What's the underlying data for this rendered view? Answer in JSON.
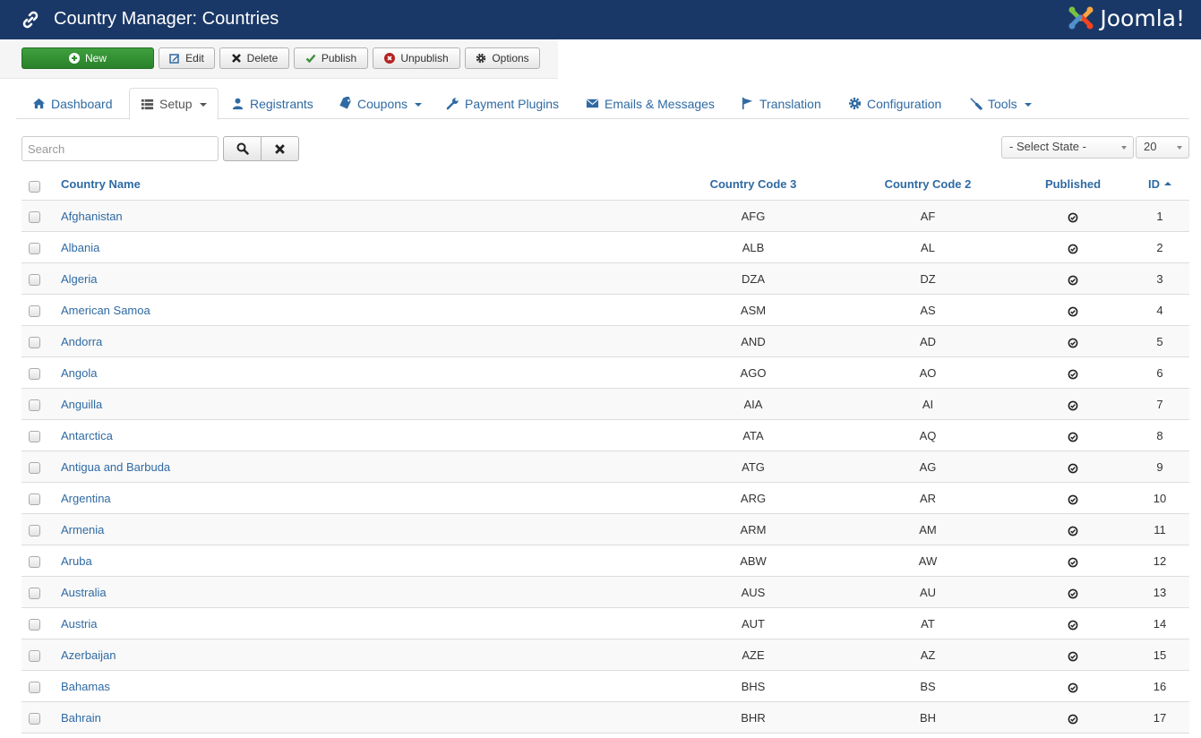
{
  "header": {
    "title": "Country Manager: Countries",
    "title_icon": "link-icon",
    "logo_text": "Joomla!",
    "background_color": "#1a3867"
  },
  "toolbar": {
    "buttons": [
      {
        "label": "New",
        "icon": "plus-circle-icon"
      },
      {
        "label": "Edit",
        "icon": "edit-icon"
      },
      {
        "label": "Delete",
        "icon": "x-icon"
      },
      {
        "label": "Publish",
        "icon": "check-icon"
      },
      {
        "label": "Unpublish",
        "icon": "x-circle-icon"
      },
      {
        "label": "Options",
        "icon": "gear-icon"
      }
    ],
    "new_color": "#2f8f2f"
  },
  "tabs": [
    {
      "label": "Dashboard",
      "icon": "home-icon",
      "dropdown": false
    },
    {
      "label": "Setup",
      "icon": "list-icon",
      "dropdown": true,
      "active": true
    },
    {
      "label": "Registrants",
      "icon": "user-icon",
      "dropdown": false
    },
    {
      "label": "Coupons",
      "icon": "tag-icon",
      "dropdown": true
    },
    {
      "label": "Payment Plugins",
      "icon": "wrench-icon",
      "dropdown": false
    },
    {
      "label": "Emails & Messages",
      "icon": "envelope-icon",
      "dropdown": false
    },
    {
      "label": "Translation",
      "icon": "flag-icon",
      "dropdown": false
    },
    {
      "label": "Configuration",
      "icon": "gear-icon",
      "dropdown": false
    },
    {
      "label": "Tools",
      "icon": "screwdriver-icon",
      "dropdown": true
    }
  ],
  "filters": {
    "search_placeholder": "Search",
    "search_value": "",
    "state_select": "- Select State -",
    "limit_select": "20"
  },
  "table": {
    "columns": {
      "name": "Country Name",
      "code3": "Country Code 3",
      "code2": "Country Code 2",
      "published": "Published",
      "id": "ID"
    },
    "sort": {
      "column": "ID",
      "direction": "asc"
    },
    "rows": [
      {
        "name": "Afghanistan",
        "code3": "AFG",
        "code2": "AF",
        "published": true,
        "id": "1"
      },
      {
        "name": "Albania",
        "code3": "ALB",
        "code2": "AL",
        "published": true,
        "id": "2"
      },
      {
        "name": "Algeria",
        "code3": "DZA",
        "code2": "DZ",
        "published": true,
        "id": "3"
      },
      {
        "name": "American Samoa",
        "code3": "ASM",
        "code2": "AS",
        "published": true,
        "id": "4"
      },
      {
        "name": "Andorra",
        "code3": "AND",
        "code2": "AD",
        "published": true,
        "id": "5"
      },
      {
        "name": "Angola",
        "code3": "AGO",
        "code2": "AO",
        "published": true,
        "id": "6"
      },
      {
        "name": "Anguilla",
        "code3": "AIA",
        "code2": "AI",
        "published": true,
        "id": "7"
      },
      {
        "name": "Antarctica",
        "code3": "ATA",
        "code2": "AQ",
        "published": true,
        "id": "8"
      },
      {
        "name": "Antigua and Barbuda",
        "code3": "ATG",
        "code2": "AG",
        "published": true,
        "id": "9"
      },
      {
        "name": "Argentina",
        "code3": "ARG",
        "code2": "AR",
        "published": true,
        "id": "10"
      },
      {
        "name": "Armenia",
        "code3": "ARM",
        "code2": "AM",
        "published": true,
        "id": "11"
      },
      {
        "name": "Aruba",
        "code3": "ABW",
        "code2": "AW",
        "published": true,
        "id": "12"
      },
      {
        "name": "Australia",
        "code3": "AUS",
        "code2": "AU",
        "published": true,
        "id": "13"
      },
      {
        "name": "Austria",
        "code3": "AUT",
        "code2": "AT",
        "published": true,
        "id": "14"
      },
      {
        "name": "Azerbaijan",
        "code3": "AZE",
        "code2": "AZ",
        "published": true,
        "id": "15"
      },
      {
        "name": "Bahamas",
        "code3": "BHS",
        "code2": "BS",
        "published": true,
        "id": "16"
      },
      {
        "name": "Bahrain",
        "code3": "BHR",
        "code2": "BH",
        "published": true,
        "id": "17"
      }
    ]
  }
}
